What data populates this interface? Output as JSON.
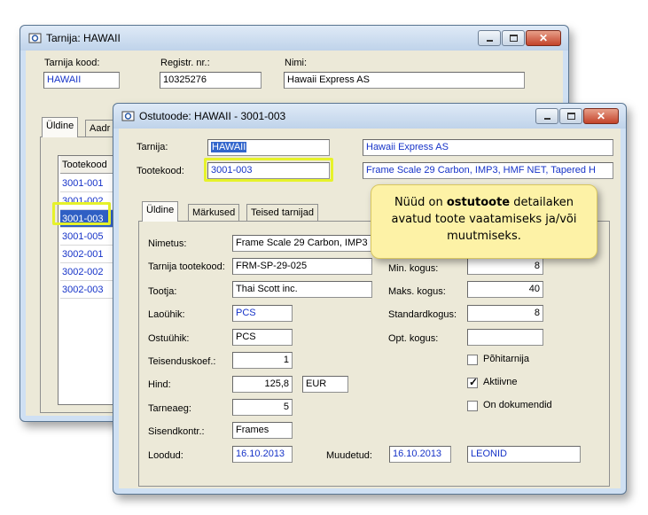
{
  "back_window": {
    "title": "Tarnija: HAWAII",
    "fields": {
      "supplier_code_label": "Tarnija kood:",
      "supplier_code": "HAWAII",
      "reg_no_label": "Registr. nr.:",
      "reg_no": "10325276",
      "name_label": "Nimi:",
      "name": "Hawaii Express AS"
    },
    "tabs": [
      "Üldine",
      "Aadr"
    ],
    "list_header": "Tootekood",
    "list_items": [
      "3001-001",
      "3001-002",
      "3001-003",
      "3001-005",
      "3002-001",
      "3002-002",
      "3002-003"
    ],
    "selected_item": "3001-003"
  },
  "front_window": {
    "title": "Ostutoode: HAWAII - 3001-003",
    "supplier_label": "Tarnija:",
    "supplier_code": "HAWAII",
    "supplier_name": "Hawaii Express AS",
    "product_code_label": "Tootekood:",
    "product_code": "3001-003",
    "product_desc": "Frame Scale 29 Carbon, IMP3, HMF NET, Tapered H",
    "tabs": [
      "Üldine",
      "Märkused",
      "Teised tarnijad"
    ],
    "form": {
      "name_label": "Nimetus:",
      "name_value": "Frame Scale 29 Carbon, IMP3",
      "supplier_product_code_label": "Tarnija tootekood:",
      "supplier_product_code": "FRM-SP-29-025",
      "manufacturer_label": "Tootja:",
      "manufacturer": "Thai Scott inc.",
      "stock_unit_label": "Laoühik:",
      "stock_unit": "PCS",
      "purchase_unit_label": "Ostuühik:",
      "purchase_unit": "PCS",
      "conversion_label": "Teisenduskoef.:",
      "conversion": "1",
      "price_label": "Hind:",
      "price": "125,8",
      "currency": "EUR",
      "lead_time_label": "Tarneaeg:",
      "lead_time": "5",
      "input_account_label": "Sisendkontr.:",
      "input_account": "Frames",
      "created_label": "Loodud:",
      "created": "16.10.2013",
      "modified_label": "Muudetud:",
      "modified": "16.10.2013",
      "modified_by": "LEONID",
      "min_qty_label": "Min. kogus:",
      "min_qty": "8",
      "max_qty_label": "Maks. kogus:",
      "max_qty": "40",
      "std_qty_label": "Standardkogus:",
      "std_qty": "8",
      "opt_qty_label": "Opt. kogus:",
      "opt_qty": "",
      "main_supplier_label": "Põhitarnija",
      "main_supplier_checked": false,
      "active_label": "Aktiivne",
      "active_checked": true,
      "on_documents_label": "On dokumendid",
      "on_documents_checked": false
    }
  },
  "callout": {
    "text_before": "Nüüd on ",
    "text_bold": "ostutoote",
    "text_after": " detailaken avatud toote vaatamiseks ja/või muutmiseks."
  }
}
